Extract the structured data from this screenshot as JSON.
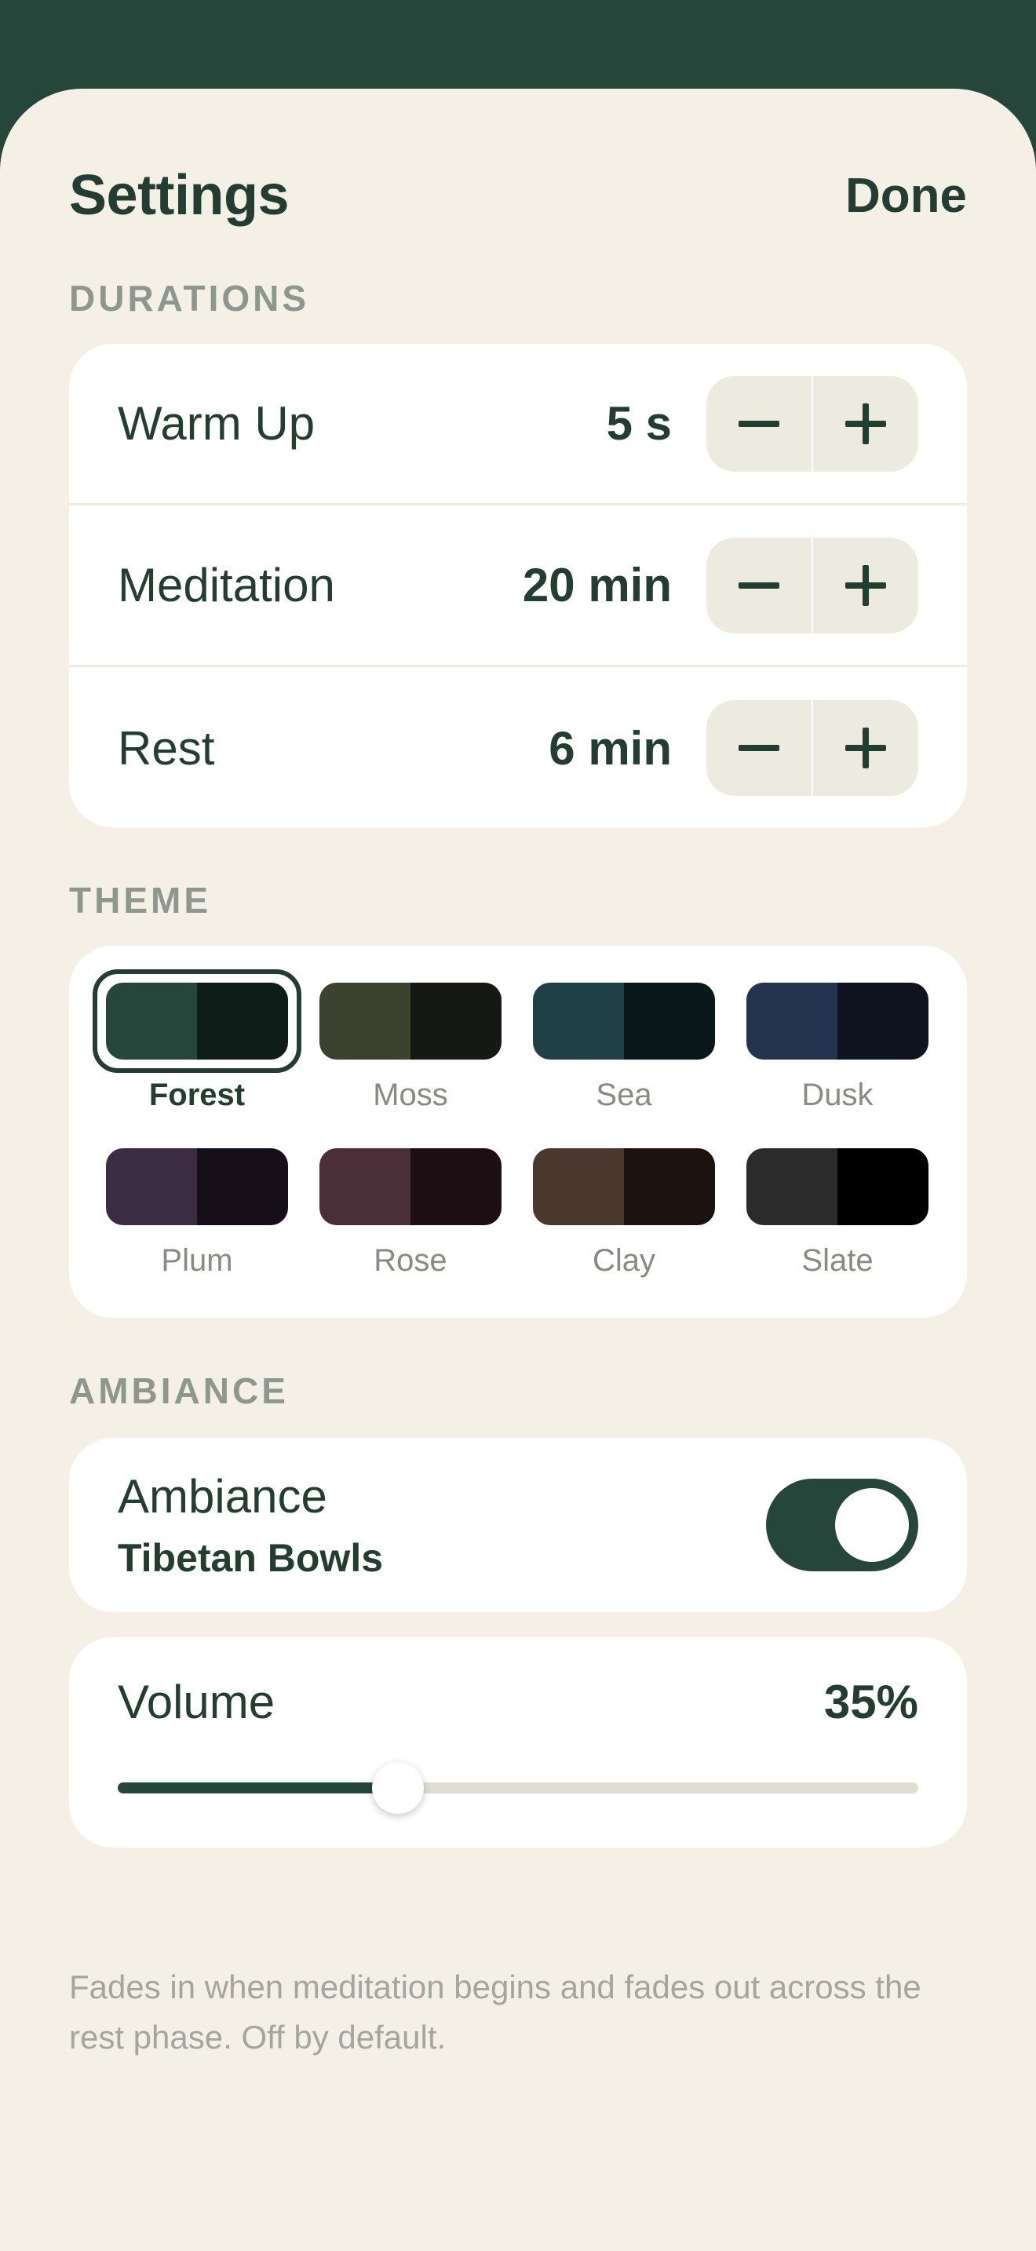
{
  "header": {
    "title": "Settings",
    "done_label": "Done"
  },
  "durations": {
    "section_label": "DURATIONS",
    "rows": [
      {
        "label": "Warm Up",
        "value": "5 s",
        "decrement_icon": "minus-icon",
        "increment_icon": "plus-icon"
      },
      {
        "label": "Meditation",
        "value": "20 min",
        "decrement_icon": "minus-icon",
        "increment_icon": "plus-icon"
      },
      {
        "label": "Rest",
        "value": "6 min",
        "decrement_icon": "minus-icon",
        "increment_icon": "plus-icon"
      }
    ]
  },
  "theme": {
    "section_label": "THEME",
    "selected": "Forest",
    "swatches": [
      {
        "name": "Forest",
        "colors": [
          "#26463b",
          "#0f1d18"
        ]
      },
      {
        "name": "Moss",
        "colors": [
          "#3b4330",
          "#161913"
        ]
      },
      {
        "name": "Sea",
        "colors": [
          "#1f4146",
          "#0a1719"
        ]
      },
      {
        "name": "Dusk",
        "colors": [
          "#24344f",
          "#0f1320"
        ]
      },
      {
        "name": "Plum",
        "colors": [
          "#3b2b43",
          "#160f1a"
        ]
      },
      {
        "name": "Rose",
        "colors": [
          "#4a2f38",
          "#1c0e13"
        ]
      },
      {
        "name": "Clay",
        "colors": [
          "#4a372d",
          "#1c1310"
        ]
      },
      {
        "name": "Slate",
        "colors": [
          "#2b2b2b",
          "#000000"
        ]
      }
    ]
  },
  "ambiance": {
    "section_label": "AMBIANCE",
    "title": "Ambiance",
    "sound": "Tibetan Bowls",
    "enabled": true,
    "volume_label": "Volume",
    "volume_text": "35%",
    "volume_fraction": 0.35,
    "footnote": "Fades in when meditation begins and fades out across the rest phase. Off by default."
  },
  "colors": {
    "accent": "#26463b",
    "background": "#f4f0e5",
    "card": "#ffffff",
    "section_label": "#8d978e"
  }
}
